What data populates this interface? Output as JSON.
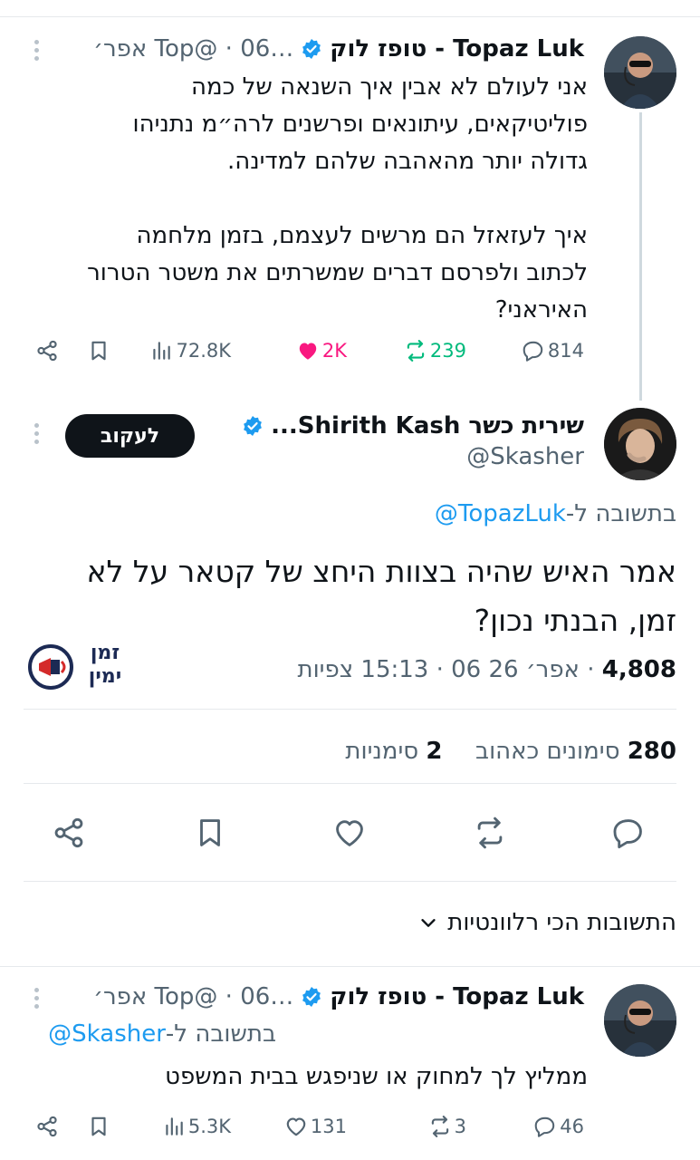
{
  "tweet1": {
    "name": "Topaz Luk - טופז לוק",
    "meta": "…Top@ · 06 אפר׳",
    "body": "אני לעולם לא אבין איך השנאה של כמה\nפוליטיקאים, עיתונאים ופרשנים לרה״מ נתניהו\nגדולה יותר מהאהבה שלהם למדינה.\n\nאיך לעזאזל הם מרשים לעצמם, בזמן מלחמה\nלכתוב ולפרסם דברים שמשרתים את משטר הטרור\nהאיראני?",
    "replies": "814",
    "reposts": "239",
    "likes": "2K",
    "views": "72.8K"
  },
  "main": {
    "name": "שירית כשר Shirith Kash...",
    "handle": "@Skasher",
    "follow_label": "לעקוב",
    "reply_prefix": "בתשובה ל-",
    "reply_to": "@TopazLuk",
    "body": "אמר האיש שהיה בצוות היחצ של קטאר על לא\nזמן, הבנתי נכון?",
    "time": "15:13 · 06 אפר׳ 26 ·",
    "views_count": "4,808",
    "views_label": "צפיות",
    "logo_line1": "זמן",
    "logo_line2": "ימין",
    "likes_count": "280",
    "likes_label": "סימונים כאהוב",
    "bookmarks_count": "2",
    "bookmarks_label": "סימניות"
  },
  "sort": {
    "label": "התשובות הכי רלוונטיות"
  },
  "tweet2": {
    "name": "Topaz Luk - טופז לוק",
    "meta": "…Top@ · 06 אפר׳",
    "reply_prefix": "בתשובה ל-",
    "reply_to": "@Skasher",
    "body": "ממליץ לך למחוק או שניפגש בבית המשפט",
    "replies": "46",
    "reposts": "3",
    "likes": "131",
    "views": "5.3K"
  },
  "colors": {
    "verified": "#1d9bf0",
    "like_active": "#f91880",
    "repost_active": "#00ba7c",
    "link": "#1d9bf0",
    "muted": "#536471"
  }
}
